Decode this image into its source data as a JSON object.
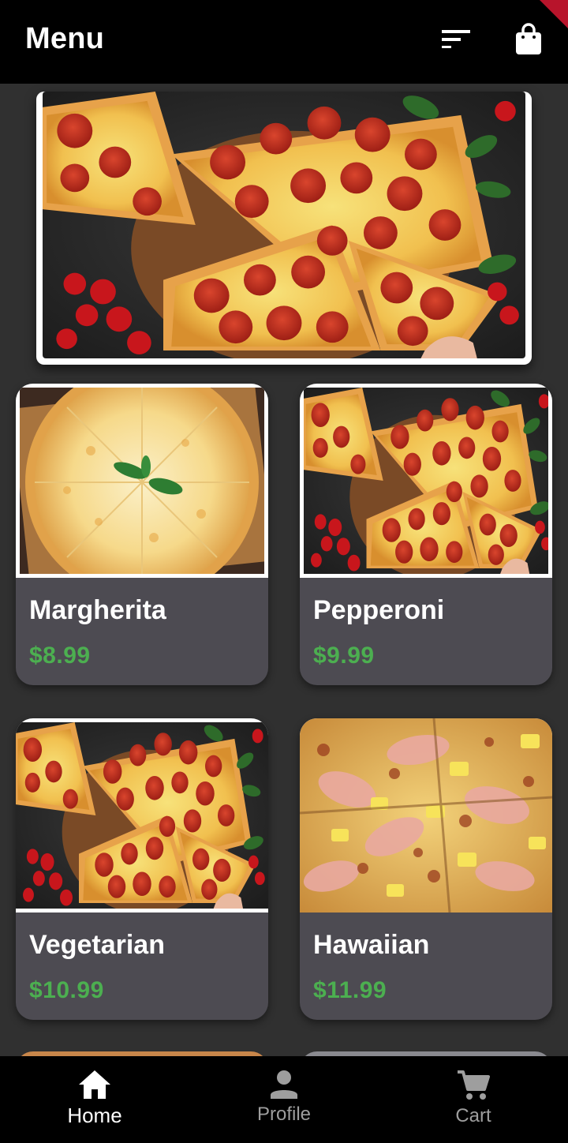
{
  "appbar": {
    "title": "Menu",
    "filter_icon": "sort-icon",
    "cart_icon": "shopping-bag-icon"
  },
  "hero": {
    "image": "pepperoni-pizza-banner"
  },
  "menu": {
    "items": [
      {
        "name": "Margherita",
        "price": "$8.99",
        "image": "margherita-pizza"
      },
      {
        "name": "Pepperoni",
        "price": "$9.99",
        "image": "pepperoni-pizza"
      },
      {
        "name": "Vegetarian",
        "price": "$10.99",
        "image": "pepperoni-pizza"
      },
      {
        "name": "Hawaiian",
        "price": "$11.99",
        "image": "hawaiian-pizza"
      }
    ]
  },
  "nav": {
    "items": [
      {
        "label": "Home",
        "icon": "home-icon",
        "active": true
      },
      {
        "label": "Profile",
        "icon": "person-icon",
        "active": false
      },
      {
        "label": "Cart",
        "icon": "cart-icon",
        "active": false
      }
    ]
  },
  "colors": {
    "appbar": "#000000",
    "background": "#303030",
    "card": "#4d4b52",
    "price": "#4caf50",
    "nav_inactive": "#9e9e9e"
  }
}
